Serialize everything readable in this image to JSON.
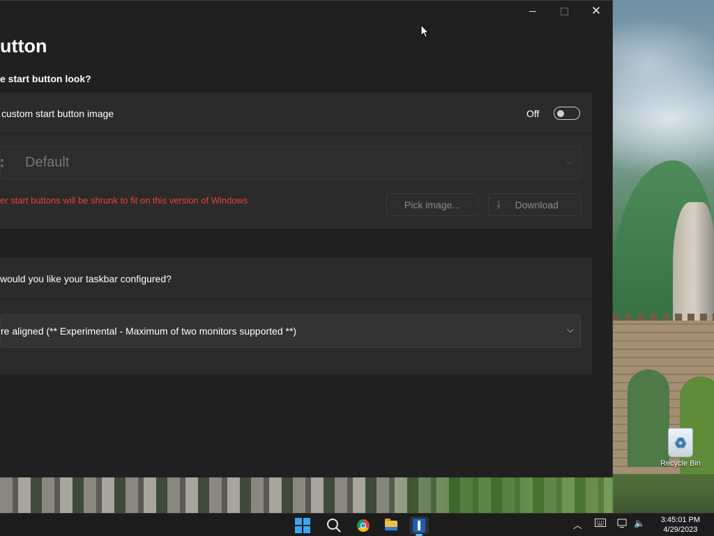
{
  "window": {
    "page_title": "utton",
    "section_look_title": "e start button look?",
    "custom_image_label": "custom start button image",
    "toggle": {
      "state_label": "Off",
      "value": false
    },
    "image_combo": {
      "value": "Default"
    },
    "warning_text": "er start buttons will be shrunk to fit on this version of Windows",
    "pick_image_label": "Pick image...",
    "download_label": "Download",
    "taskbar_question": "would you like your taskbar configured?",
    "taskbar_combo": {
      "value": "re aligned (** Experimental - Maximum of two monitors supported **)"
    }
  },
  "desktop": {
    "icons": [
      {
        "label": "Recycle Bin"
      }
    ]
  },
  "taskbar": {
    "apps": [
      {
        "name": "start",
        "icon": "windows-logo-icon"
      },
      {
        "name": "search",
        "icon": "search-icon"
      },
      {
        "name": "chrome",
        "icon": "chrome-icon"
      },
      {
        "name": "file-explorer",
        "icon": "folder-icon"
      },
      {
        "name": "active-app",
        "icon": "app-icon"
      }
    ],
    "clock": {
      "time": "3:45:01 PM",
      "date": "4/29/2023"
    }
  },
  "colors": {
    "accent": "#3aa7f2",
    "warning": "#e8403a",
    "window_bg": "#202020",
    "card_bg": "#2b2b2b"
  }
}
